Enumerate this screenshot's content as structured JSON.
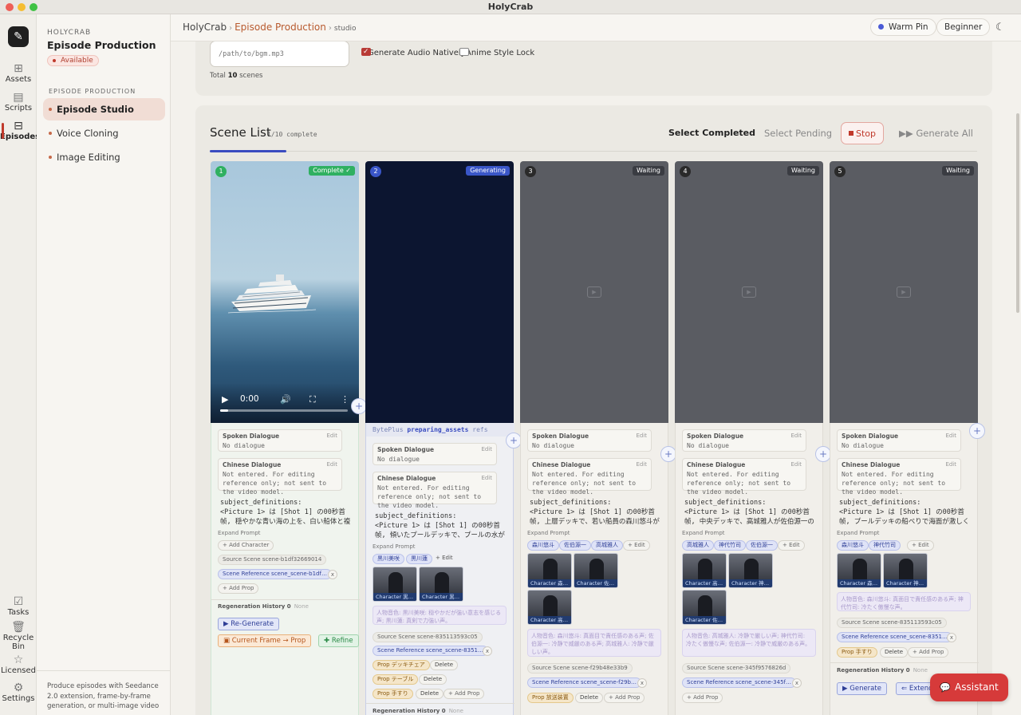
{
  "window": {
    "title": "HolyCrab"
  },
  "rail": {
    "items": [
      {
        "label": "Assets",
        "icon": "assets-icon"
      },
      {
        "label": "Scripts",
        "icon": "scripts-icon"
      },
      {
        "label": "Episodes",
        "icon": "episodes-icon"
      },
      {
        "label": "Tasks",
        "icon": "tasks-icon"
      },
      {
        "label": "Recycle Bin",
        "icon": "recycle-bin-icon"
      },
      {
        "label": "Licensed",
        "icon": "licensed-icon"
      },
      {
        "label": "Settings",
        "icon": "settings-icon"
      }
    ]
  },
  "sidebar": {
    "brand": "HOLYCRAB",
    "title": "Episode Production",
    "badge": "Available",
    "section": "EPISODE PRODUCTION",
    "items": [
      "Episode Studio",
      "Voice Cloning",
      "Image Editing"
    ],
    "footer": "Produce episodes with Seedance 2.0 extension, frame-by-frame generation, or multi-image video"
  },
  "header": {
    "breadcrumb": [
      "HolyCrab",
      "Episode Production",
      "studio"
    ],
    "pin_label": "Warm Pin",
    "level_label": "Beginner"
  },
  "settings": {
    "bgm_placeholder": "/path/to/bgm.mp3",
    "audio_label": "Generate Audio Natively",
    "audio_checked": true,
    "anime_label": "Anime Style Lock",
    "anime_checked": false,
    "total_prefix": "Total",
    "total_count": "10",
    "total_suffix": "scenes"
  },
  "scene_list": {
    "title": "Scene List",
    "progress": "1/10 complete",
    "select_completed": "Select Completed",
    "select_pending": "Select Pending",
    "stop": "Stop",
    "generate_all": "Generate All",
    "labels": {
      "spoken": "Spoken Dialogue",
      "edit": "Edit",
      "no_dialogue": "No dialogue",
      "chinese": "Chinese Dialogue",
      "chinese_hint": "Not entered. For editing reference only; not sent to the video model.",
      "expand": "Expand Prompt",
      "add_character": "+ Add Character",
      "add_edit": "+ Edit",
      "add_prop": "+ Add Prop",
      "delete": "Delete",
      "regen_history": "Regeneration History 0",
      "none": "None",
      "regenerate": "Re-Generate",
      "frame_prop": "Current Frame → Prop",
      "refine": "Refine",
      "generate": "Generate",
      "extend": "Extend",
      "video_time": "0:00"
    },
    "scenes": [
      {
        "number": "1",
        "status": "Complete ✓",
        "prompt_head": "subject_definitions:",
        "prompt_body": "<Picture 1> は [Shot 1] の00秒首帧, 穏やかな青い海の上を、白い船体と複数の…",
        "source": "Source Scene scene-b1df32669014",
        "scene_ref": "Scene Reference scene_scene-b1df…"
      },
      {
        "number": "2",
        "status": "Generating",
        "refs_provider": "BytePlus",
        "refs_state": "preparing_assets",
        "refs_suffix": "refs",
        "prompt_head": "subject_definitions:",
        "prompt_body": "<Picture 1> は [Shot 1] の00秒首帧, 傾いたプールデッキで、プールの水が甲板…",
        "chars": [
          "黒川美咲",
          "黒川蓮"
        ],
        "thumbs": [
          "Character 黒…",
          "Character 黒…"
        ],
        "voice": "人物音色: 黒川美咲: 穏やかだが強い意志を感じる声; 黒川蓮: 真剣で力強い声。",
        "source": "Source Scene scene-835113593c05",
        "scene_ref": "Scene Reference scene_scene-8351…",
        "props": [
          "Prop デッキチェア",
          "Prop テーブル",
          "Prop 手すり"
        ],
        "regen": "Regeneration History 0"
      },
      {
        "number": "3",
        "status": "Waiting",
        "prompt_head": "subject_definitions:",
        "prompt_body": "<Picture 1> は [Shot 1] の00秒首帧, 上層デッキで、若い船員の森川悠斗が黒い…",
        "chars": [
          "森川悠斗",
          "佐伯源一",
          "高城雅人"
        ],
        "thumbs": [
          "Character 森…",
          "Character 佐…",
          "Character 高…"
        ],
        "voice": "人物音色: 森川悠斗: 真面目で責任感のある声; 佐伯源一: 冷静で威厳のある声; 高城雅人: 冷静で厳しい声。",
        "source": "Source Scene scene-f29b48e33b9",
        "scene_ref": "Scene Reference scene_scene-f29b…",
        "props": [
          "Prop 放送装置"
        ]
      },
      {
        "number": "4",
        "status": "Waiting",
        "prompt_head": "subject_definitions:",
        "prompt_body": "<Picture 1> は [Shot 1] の00秒首帧, 中央デッキで、高城雅人が佐伯源一の前に…",
        "chars": [
          "高城雅人",
          "神代竹司",
          "佐伯源一"
        ],
        "thumbs": [
          "Character 高…",
          "Character 神…",
          "Character 佐…"
        ],
        "voice": "人物音色: 高城雅人: 冷静で厳しい声; 神代竹司: 冷たく傲慢な声; 佐伯源一: 冷静で威厳のある声。",
        "source": "Source Scene scene-345f9576826d",
        "scene_ref": "Scene Reference scene_scene-345f…"
      },
      {
        "number": "5",
        "status": "Waiting",
        "prompt_head": "subject_definitions:",
        "prompt_body": "<Picture 1> は [Shot 1] の00秒首帧, プールデッキの船べりで海面が激しく盛り…",
        "chars": [
          "森川悠斗",
          "神代竹司"
        ],
        "thumbs": [
          "Character 森…",
          "Character 神…"
        ],
        "voice": "人物音色: 森川悠斗: 真面目で責任感のある声; 神代竹司: 冷たく傲慢な声。",
        "source": "Source Scene scene-835113593c05",
        "scene_ref": "Scene Reference scene_scene-8351…",
        "props": [
          "Prop 手すり"
        ]
      }
    ]
  },
  "assistant": {
    "label": "Assistant"
  },
  "colors": {
    "accent": "#b85a2e",
    "danger": "#c0392b",
    "primary": "#3a4cc0",
    "success": "#2fb061",
    "assistant": "#d63a3a"
  }
}
